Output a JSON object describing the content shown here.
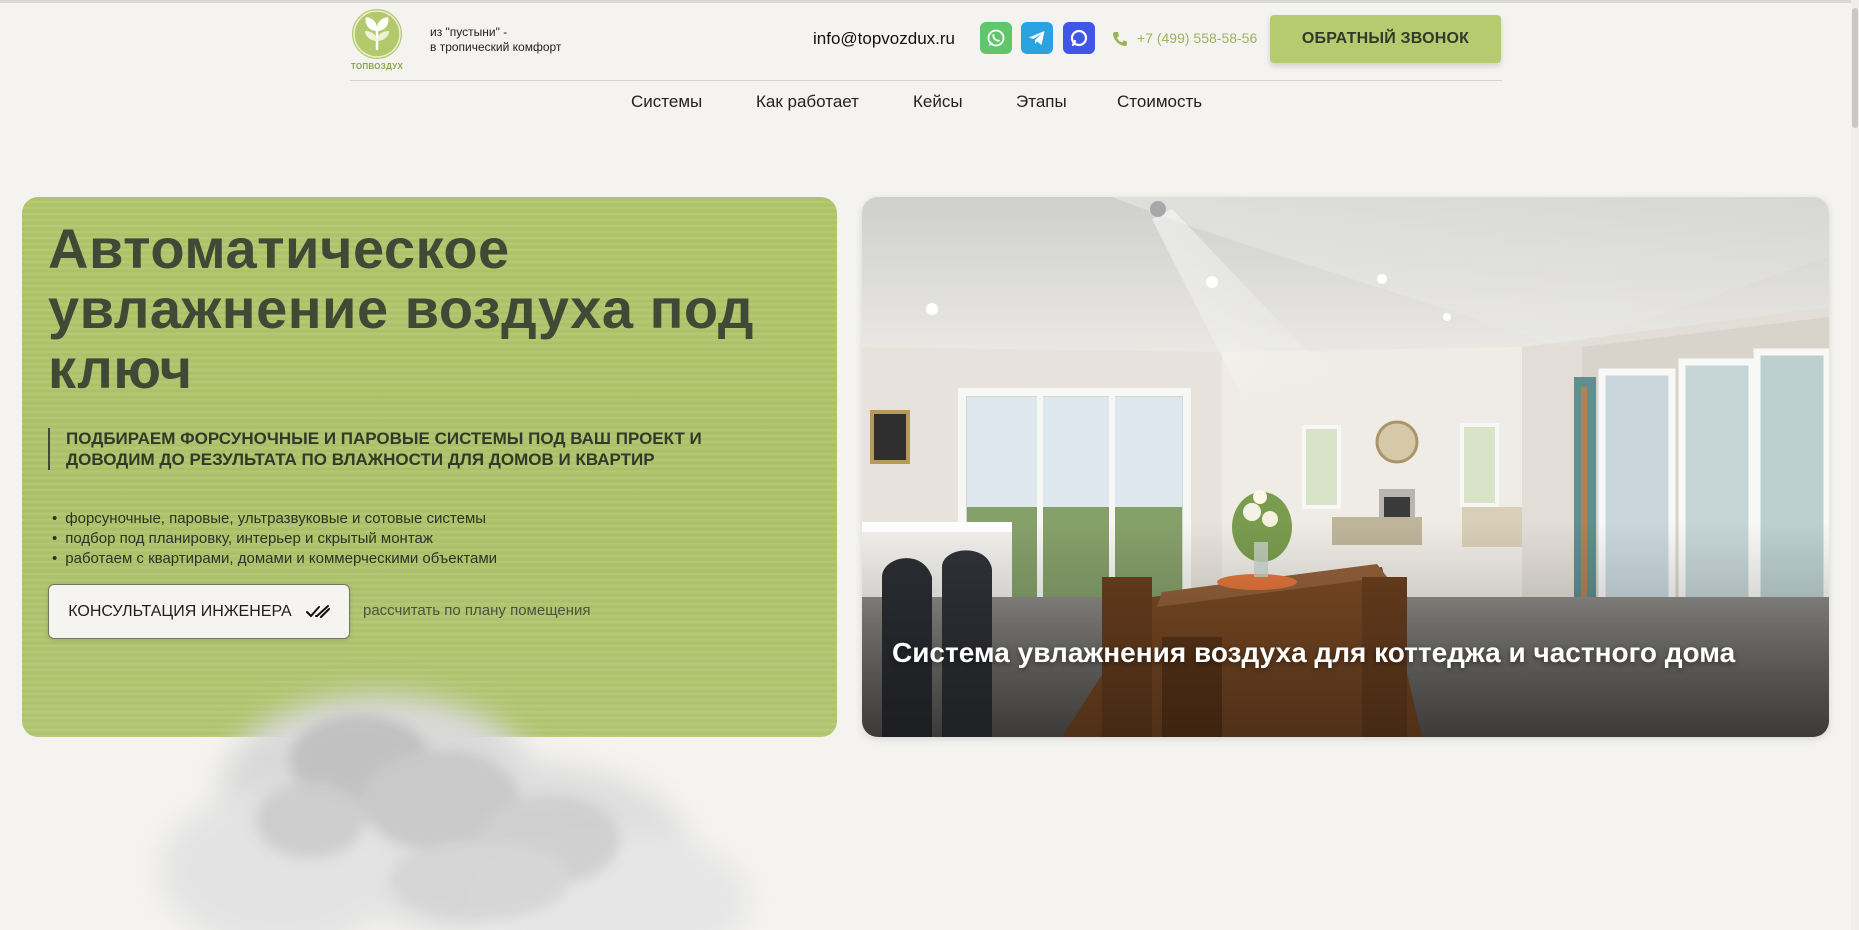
{
  "header": {
    "logo_text": "ТОПВОЗДУХ",
    "tagline_line1": "из \"пустыни\" -",
    "tagline_line2": "в тропический комфорт",
    "email": "info@topvozdux.ru",
    "phone": "+7 (499) 558-58-56",
    "callback_label": "ОБРАТНЫЙ ЗВОНОК"
  },
  "nav": {
    "items": [
      "Системы",
      "Как работает",
      "Кейсы",
      "Этапы",
      "Стоимость"
    ]
  },
  "hero": {
    "title": "Автоматическое увлажнение воздуха под ключ",
    "subtitle": "ПОДБИРАЕМ ФОРСУНОЧНЫЕ И ПАРОВЫЕ СИСТЕМЫ ПОД ВАШ ПРОЕКТ И ДОВОДИМ ДО РЕЗУЛЬТАТА ПО ВЛАЖНОСТИ ДЛЯ ДОМОВ И КВАРТИР",
    "bullets": [
      "форсуночные, паровые, ультразвуковые и сотовые системы",
      "подбор под планировку, интерьер и скрытый монтаж",
      "работаем с квартирами, домами и коммерческими объектами"
    ],
    "consult_label": "КОНСУЛЬТАЦИЯ ИНЖЕНЕРА",
    "calc_link": "рассчитать по плану помещения"
  },
  "feature": {
    "caption": "Система увлажнения воздуха для коттеджа и частного дома"
  },
  "colors": {
    "accent": "#b6cb6f",
    "hero_bg": "#b1c56a",
    "title": "#3f4a36",
    "page_bg": "#f4f3f0"
  },
  "icons": [
    "logo-leaf-icon",
    "whatsapp-icon",
    "telegram-icon",
    "max-messenger-icon",
    "phone-icon",
    "double-check-icon"
  ]
}
